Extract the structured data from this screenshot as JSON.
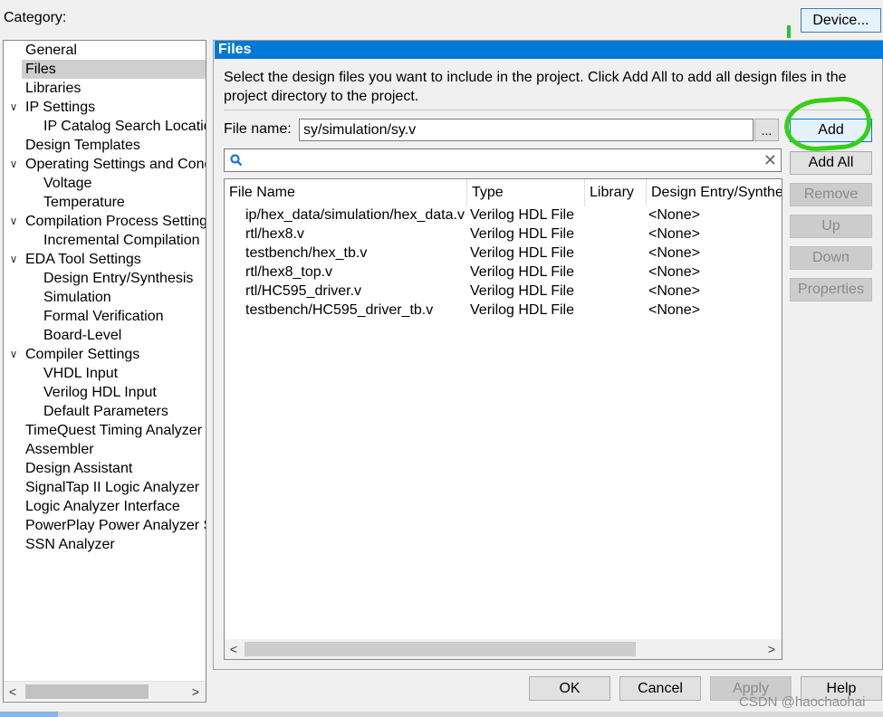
{
  "header": {
    "category_label": "Category:",
    "device_button": "Device..."
  },
  "tree": {
    "items": [
      {
        "label": "General",
        "level": 0,
        "expandable": false,
        "selected": false
      },
      {
        "label": "Files",
        "level": 0,
        "expandable": false,
        "selected": true
      },
      {
        "label": "Libraries",
        "level": 0,
        "expandable": false,
        "selected": false
      },
      {
        "label": "IP Settings",
        "level": 0,
        "expandable": true,
        "selected": false
      },
      {
        "label": "IP Catalog Search Locations",
        "level": 1,
        "expandable": false,
        "selected": false
      },
      {
        "label": "Design Templates",
        "level": 0,
        "expandable": false,
        "selected": false
      },
      {
        "label": "Operating Settings and Conditions",
        "level": 0,
        "expandable": true,
        "selected": false
      },
      {
        "label": "Voltage",
        "level": 1,
        "expandable": false,
        "selected": false
      },
      {
        "label": "Temperature",
        "level": 1,
        "expandable": false,
        "selected": false
      },
      {
        "label": "Compilation Process Settings",
        "level": 0,
        "expandable": true,
        "selected": false
      },
      {
        "label": "Incremental Compilation",
        "level": 1,
        "expandable": false,
        "selected": false
      },
      {
        "label": "EDA Tool Settings",
        "level": 0,
        "expandable": true,
        "selected": false
      },
      {
        "label": "Design Entry/Synthesis",
        "level": 1,
        "expandable": false,
        "selected": false
      },
      {
        "label": "Simulation",
        "level": 1,
        "expandable": false,
        "selected": false
      },
      {
        "label": "Formal Verification",
        "level": 1,
        "expandable": false,
        "selected": false
      },
      {
        "label": "Board-Level",
        "level": 1,
        "expandable": false,
        "selected": false
      },
      {
        "label": "Compiler Settings",
        "level": 0,
        "expandable": true,
        "selected": false
      },
      {
        "label": "VHDL Input",
        "level": 1,
        "expandable": false,
        "selected": false
      },
      {
        "label": "Verilog HDL Input",
        "level": 1,
        "expandable": false,
        "selected": false
      },
      {
        "label": "Default Parameters",
        "level": 1,
        "expandable": false,
        "selected": false
      },
      {
        "label": "TimeQuest Timing Analyzer",
        "level": 0,
        "expandable": false,
        "selected": false
      },
      {
        "label": "Assembler",
        "level": 0,
        "expandable": false,
        "selected": false
      },
      {
        "label": "Design Assistant",
        "level": 0,
        "expandable": false,
        "selected": false
      },
      {
        "label": "SignalTap II Logic Analyzer",
        "level": 0,
        "expandable": false,
        "selected": false
      },
      {
        "label": "Logic Analyzer Interface",
        "level": 0,
        "expandable": false,
        "selected": false
      },
      {
        "label": "PowerPlay Power Analyzer Settings",
        "level": 0,
        "expandable": false,
        "selected": false
      },
      {
        "label": "SSN Analyzer",
        "level": 0,
        "expandable": false,
        "selected": false
      }
    ]
  },
  "files": {
    "header": "Files",
    "description": "Select the design files you want to include in the project. Click Add All to add all design files in the project directory to the project.",
    "filename_label": "File name:",
    "filename_value": "sy/simulation/sy.v",
    "browse_label": "...",
    "search_value": "",
    "columns": [
      "File Name",
      "Type",
      "Library",
      "Design Entry/Synthesis Tool"
    ],
    "rows": [
      [
        "ip/hex_data/simulation/hex_data.v",
        "Verilog HDL File",
        "",
        "<None>"
      ],
      [
        "rtl/hex8.v",
        "Verilog HDL File",
        "",
        "<None>"
      ],
      [
        "testbench/hex_tb.v",
        "Verilog HDL File",
        "",
        "<None>"
      ],
      [
        "rtl/hex8_top.v",
        "Verilog HDL File",
        "",
        "<None>"
      ],
      [
        "rtl/HC595_driver.v",
        "Verilog HDL File",
        "",
        "<None>"
      ],
      [
        "testbench/HC595_driver_tb.v",
        "Verilog HDL File",
        "",
        "<None>"
      ]
    ],
    "buttons": {
      "add": "Add",
      "add_all": "Add All",
      "remove": "Remove",
      "up": "Up",
      "down": "Down",
      "properties": "Properties"
    }
  },
  "footer": {
    "ok": "OK",
    "cancel": "Cancel",
    "apply": "Apply",
    "help": "Help"
  },
  "watermark": "CSDN @haochaohai",
  "colors": {
    "accent": "#0078d7",
    "annotation_green": "#35d016",
    "selection": "#cfcfcf"
  }
}
